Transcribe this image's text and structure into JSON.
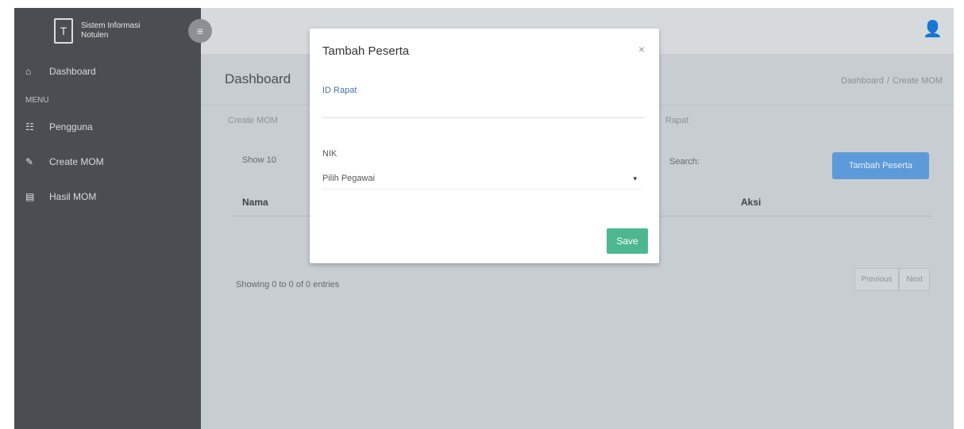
{
  "brand": {
    "logo_glyph": "T",
    "line1": "Sistem Informasi",
    "line2": "Notulen"
  },
  "sidebar": {
    "items": [
      {
        "label": "Dashboard",
        "icon": "home-icon",
        "glyph": "⌂"
      },
      {
        "label": "Pengguna",
        "icon": "users-icon",
        "glyph": "☷"
      },
      {
        "label": "Create MOM",
        "icon": "edit-icon",
        "glyph": "✎"
      },
      {
        "label": "Hasil MOM",
        "icon": "document-icon",
        "glyph": "▤"
      }
    ],
    "section_header": "MENU"
  },
  "topbar": {
    "toggle_glyph": "≡",
    "user_glyph": "👤"
  },
  "content": {
    "title": "Dashboard",
    "breadcrumb": [
      "Dashboard",
      "Create MOM"
    ],
    "card_title": "Create MOM",
    "card_title_right": "Rapat",
    "show_label": "Show",
    "show_value": "10",
    "search_label": "Search:",
    "add_button": "Tambah Peserta",
    "columns": [
      "Nama",
      "Aksi"
    ],
    "showing": "Showing 0 to 0 of 0 entries",
    "pager": [
      "Previous",
      "Next"
    ]
  },
  "modal": {
    "title": "Tambah Peserta",
    "close_glyph": "×",
    "id_label": "ID Rapat",
    "id_value": "",
    "nik_label": "NIK",
    "nik_select": "Pilih Pegawai",
    "caret_glyph": "▾",
    "save_label": "Save"
  },
  "colors": {
    "sidebar": "#4a4e52",
    "save": "#4db88f",
    "add_button": "#5d9ad9",
    "id_label": "#4a6fb5"
  }
}
